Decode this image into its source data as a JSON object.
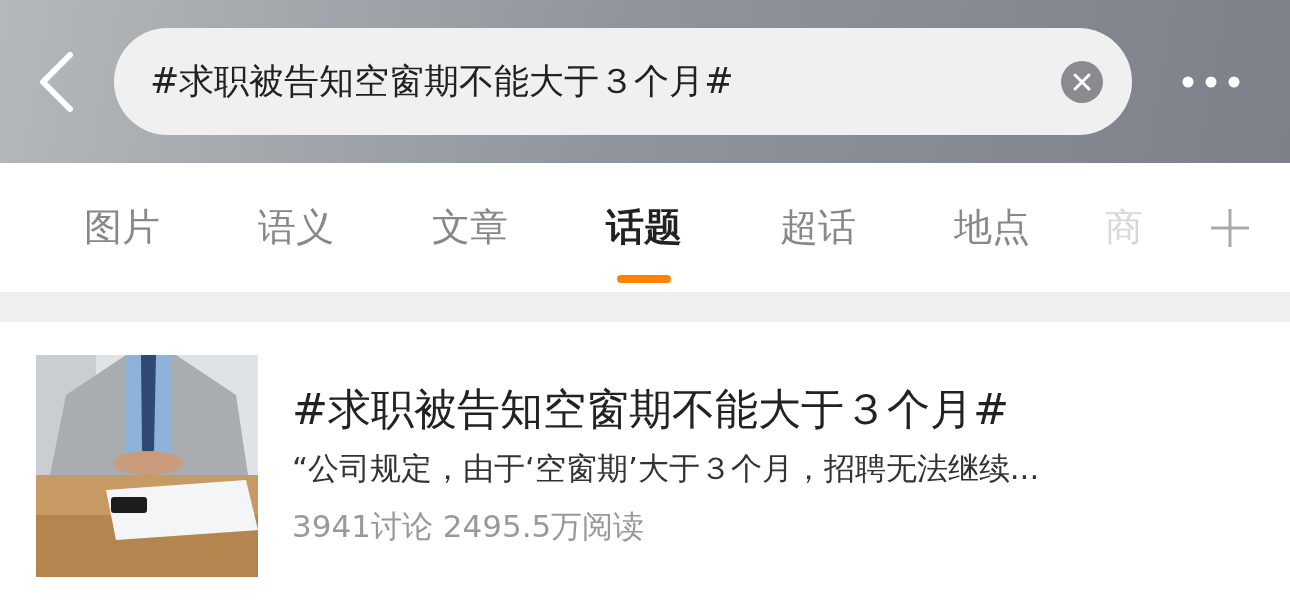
{
  "search": {
    "value": "#求职被告知空窗期不能大于３个月#"
  },
  "tabs": [
    {
      "label": "图片",
      "selected": false
    },
    {
      "label": "语义",
      "selected": false
    },
    {
      "label": "文章",
      "selected": false
    },
    {
      "label": "话题",
      "selected": true
    },
    {
      "label": "超话",
      "selected": false
    },
    {
      "label": "地点",
      "selected": false
    },
    {
      "label": "商",
      "selected": false
    }
  ],
  "results": [
    {
      "title": "#求职被告知空窗期不能大于３个月#",
      "description": "“公司规定，由于‘空窗期’大于３个月，招聘无法继续...",
      "stats": "3941讨论 2495.5万阅读"
    }
  ]
}
